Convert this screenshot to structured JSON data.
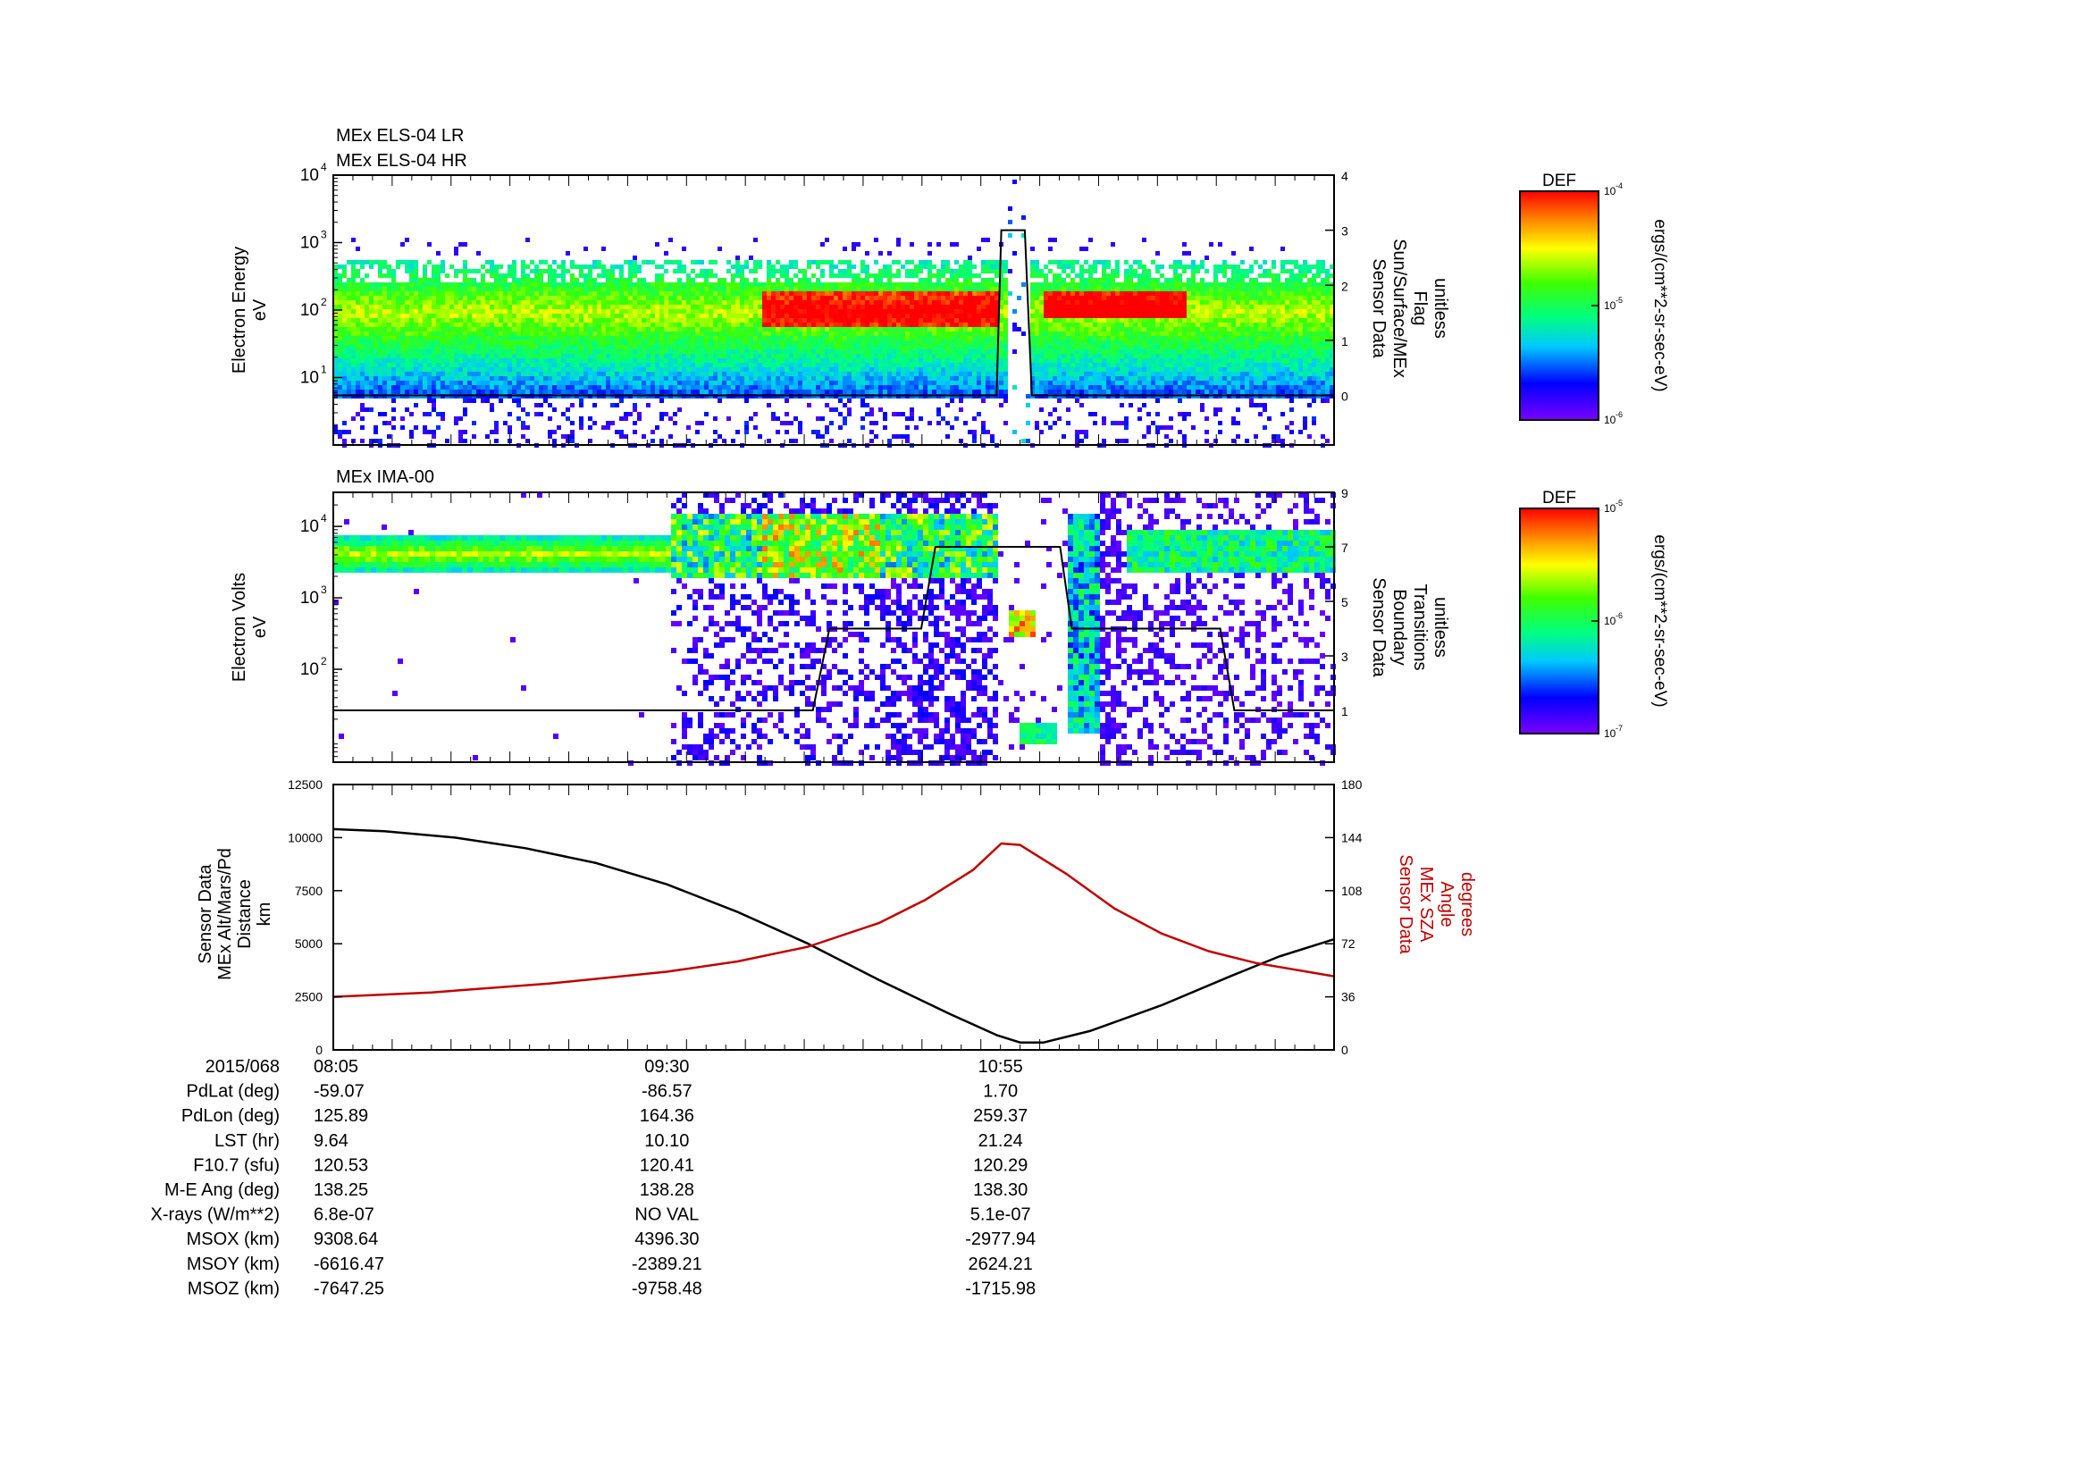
{
  "colors": {
    "sza_line": "#c00000",
    "altitude_line": "#000000",
    "flag_line": "#000000"
  },
  "colorbars": [
    {
      "title": "DEF",
      "units": "ergs/(cm**2-sr-sec-eV)",
      "ticks": [
        {
          "exp_base": "10",
          "exp": "-4",
          "level": 1.0
        },
        {
          "exp_base": "10",
          "exp": "-5",
          "level": 0.5
        },
        {
          "exp_base": "10",
          "exp": "-6",
          "level": 0.0
        }
      ]
    },
    {
      "title": "DEF",
      "units": "ergs/(cm**2-sr-sec-eV)",
      "ticks": [
        {
          "exp_base": "10",
          "exp": "-5",
          "level": 1.0
        },
        {
          "exp_base": "10",
          "exp": "-6",
          "level": 0.5
        },
        {
          "exp_base": "10",
          "exp": "-7",
          "level": 0.0
        }
      ]
    }
  ],
  "chart_data": [
    {
      "type": "heatmap",
      "titles": [
        "MEx ELS-04 LR",
        "MEx ELS-04 HR"
      ],
      "ylabel_lines": [
        "Electron Energy",
        "eV"
      ],
      "ylog": true,
      "ylim": [
        1,
        10000
      ],
      "yticks": [
        {
          "base": "10",
          "exp": "4",
          "value": 10000
        },
        {
          "base": "10",
          "exp": "3",
          "value": 1000
        },
        {
          "base": "10",
          "exp": "2",
          "value": 100
        },
        {
          "base": "10",
          "exp": "1",
          "value": 10
        }
      ],
      "right_axis": {
        "label_lines": [
          "Sensor Data",
          "Sun/Surface/MEx",
          "Flag",
          "unitless"
        ],
        "ylim": [
          -0.9,
          4
        ],
        "ticks": [
          "4",
          "3",
          "2",
          "1",
          "0"
        ],
        "tick_values": [
          4,
          3,
          2,
          1,
          0
        ]
      },
      "flag_series": {
        "x_hours": [
          8.0833,
          10.9,
          10.92,
          11.02,
          11.05,
          12.33
        ],
        "y": [
          0,
          0,
          3,
          3,
          0,
          0
        ]
      }
    },
    {
      "type": "heatmap",
      "titles": [
        "MEx IMA-00"
      ],
      "ylabel_lines": [
        "Electron Volts",
        "eV"
      ],
      "ylog": true,
      "ylim": [
        5,
        30000
      ],
      "yticks": [
        {
          "base": "10",
          "exp": "4",
          "value": 10000
        },
        {
          "base": "10",
          "exp": "3",
          "value": 1000
        },
        {
          "base": "10",
          "exp": "2",
          "value": 100
        }
      ],
      "right_axis": {
        "label_lines": [
          "Sensor Data",
          "Boundary",
          "Transitions",
          "unitless"
        ],
        "ylim": [
          -0.9,
          9
        ],
        "ticks": [
          "9",
          "7",
          "5",
          "3",
          "1"
        ],
        "tick_values": [
          9,
          7,
          5,
          3,
          1
        ]
      },
      "flag_series": {
        "x_hours": [
          8.0833,
          9.5,
          10.12,
          10.19,
          10.58,
          10.64,
          11.17,
          11.22,
          11.85,
          11.91,
          12.33
        ],
        "y": [
          1,
          1,
          1,
          4,
          4,
          7,
          7,
          4,
          4,
          1,
          1
        ]
      }
    },
    {
      "type": "line",
      "ylabel_lines": [
        "Sensor Data",
        "MEx Alt/Mars/Pd",
        "Distance",
        "km"
      ],
      "ylim": [
        0,
        12500
      ],
      "yticks": [
        "0",
        "2500",
        "5000",
        "7500",
        "10000",
        "12500"
      ],
      "ytick_values": [
        0,
        2500,
        5000,
        7500,
        10000,
        12500
      ],
      "right_axis": {
        "label_lines": [
          "Sensor Data",
          "MEx SZA",
          "Angle",
          "degrees"
        ],
        "ylim": [
          0,
          180
        ],
        "ticks": [
          "0",
          "36",
          "72",
          "108",
          "144",
          "180"
        ],
        "tick_values": [
          0,
          36,
          72,
          108,
          144,
          180
        ]
      },
      "series": [
        {
          "name": "MEx Alt/Mars/Pd Distance",
          "x_hours": [
            8.0833,
            8.3,
            8.6,
            8.9,
            9.2,
            9.5,
            9.8,
            10.1,
            10.4,
            10.7,
            10.9,
            11.0,
            11.1,
            11.3,
            11.6,
            11.9,
            12.1,
            12.33
          ],
          "y": [
            10400,
            10300,
            10000,
            9500,
            8800,
            7800,
            6500,
            5000,
            3300,
            1700,
            700,
            350,
            350,
            900,
            2100,
            3500,
            4400,
            5200
          ]
        },
        {
          "name": "MEx SZA Angle",
          "x_hours": [
            8.0833,
            8.5,
            9.0,
            9.5,
            9.8,
            10.1,
            10.4,
            10.6,
            10.8,
            10.92,
            11.0,
            11.2,
            11.4,
            11.6,
            11.8,
            12.0,
            12.33
          ],
          "y": [
            36,
            39,
            45,
            53,
            60,
            70,
            86,
            102,
            122,
            140,
            139,
            119,
            96,
            79,
            67,
            59,
            50
          ]
        }
      ],
      "xlim_hours": [
        8.0833,
        12.3333
      ]
    }
  ],
  "ephemeris": {
    "rows": [
      {
        "label": "2015/068",
        "values": [
          "08:05",
          "09:30",
          "10:55"
        ]
      },
      {
        "label": "PdLat (deg)",
        "values": [
          "-59.07",
          "-86.57",
          "1.70"
        ]
      },
      {
        "label": "PdLon (deg)",
        "values": [
          "125.89",
          "164.36",
          "259.37"
        ]
      },
      {
        "label": "LST (hr)",
        "values": [
          "9.64",
          "10.10",
          "21.24"
        ]
      },
      {
        "label": "F10.7 (sfu)",
        "values": [
          "120.53",
          "120.41",
          "120.29"
        ]
      },
      {
        "label": "M-E Ang (deg)",
        "values": [
          "138.25",
          "138.28",
          "138.30"
        ]
      },
      {
        "label": "X-rays (W/m**2)",
        "values": [
          "6.8e-07",
          "NO VAL",
          "5.1e-07"
        ]
      },
      {
        "label": "MSOX (km)",
        "values": [
          "9308.64",
          "4396.30",
          "-2977.94"
        ]
      },
      {
        "label": "MSOY (km)",
        "values": [
          "-6616.47",
          "-2389.21",
          "2624.21"
        ]
      },
      {
        "label": "MSOZ (km)",
        "values": [
          "-7647.25",
          "-9758.48",
          "-1715.98"
        ]
      }
    ]
  }
}
